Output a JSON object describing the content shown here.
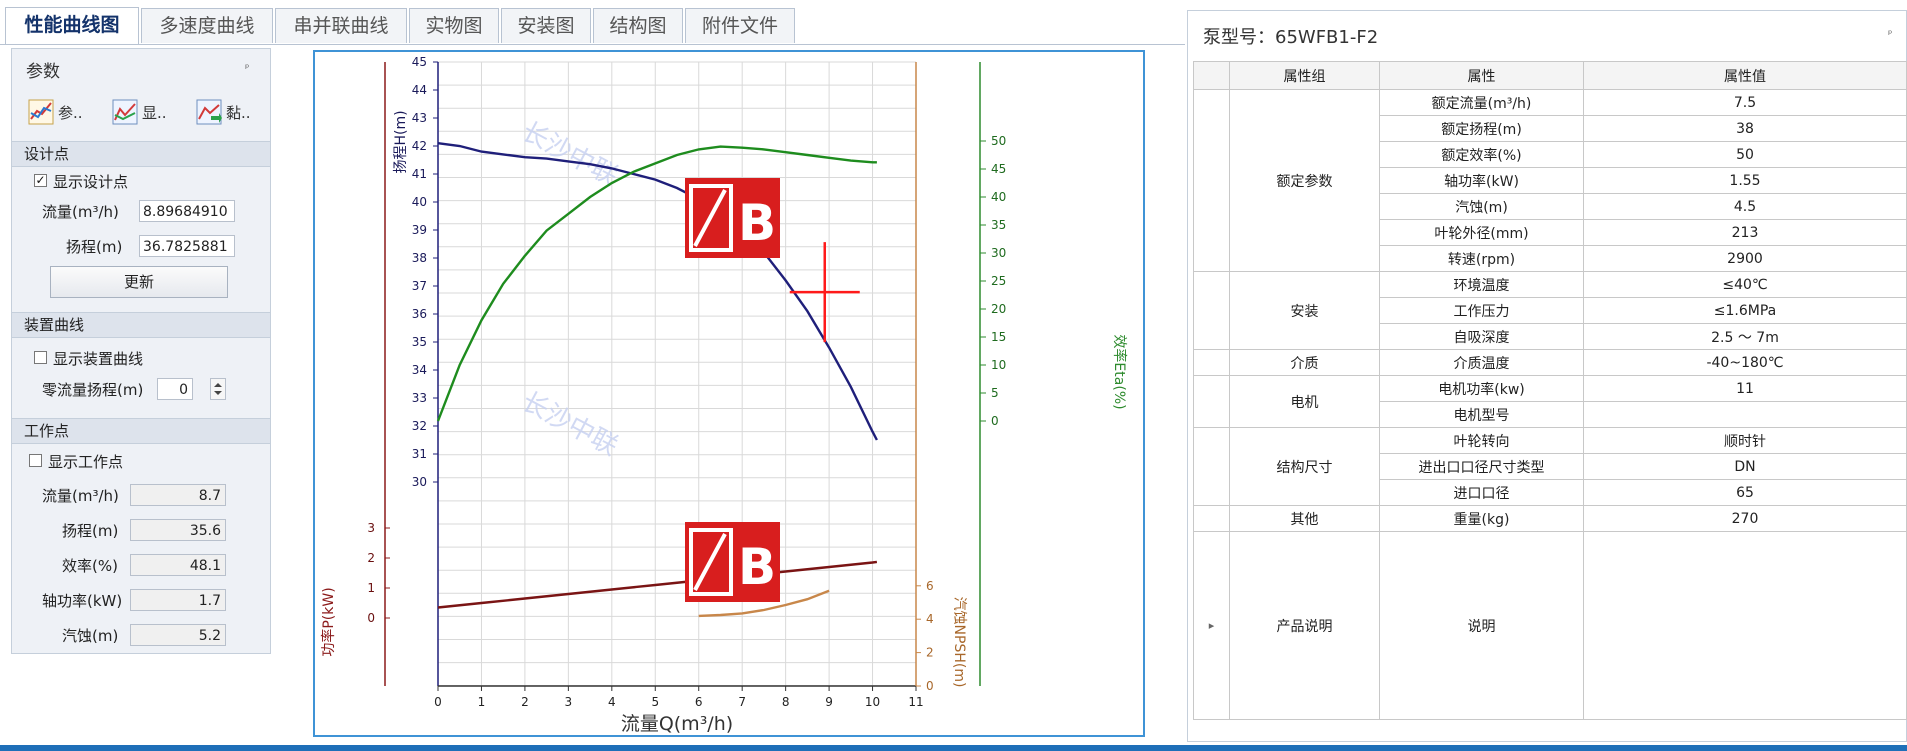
{
  "tabs": [
    "性能曲线图",
    "多速度曲线",
    "串并联曲线",
    "实物图",
    "安装图",
    "结构图",
    "附件文件"
  ],
  "left_panel": {
    "title": "参数",
    "pin_glyph": "ᵖ",
    "tools": [
      {
        "icon": "curve-chart-icon",
        "label": "参.."
      },
      {
        "icon": "display-chart-icon",
        "label": "显.."
      },
      {
        "icon": "paste-chart-icon",
        "label": "黏.."
      }
    ],
    "design_point": {
      "header": "设计点",
      "show_label": "显示设计点",
      "show_checked": true,
      "flow_label": "流量(m³/h)",
      "flow_value": "8.89684910",
      "head_label": "扬程(m)",
      "head_value": "36.7825881",
      "update_button": "更新"
    },
    "system_curve": {
      "header": "装置曲线",
      "show_label": "显示装置曲线",
      "show_checked": false,
      "zero_flow_label": "零流量扬程(m)",
      "zero_flow_value": "0"
    },
    "work_point": {
      "header": "工作点",
      "show_label": "显示工作点",
      "show_checked": false,
      "rows": [
        {
          "label": "流量(m³/h)",
          "value": "8.7"
        },
        {
          "label": "扬程(m)",
          "value": "35.6"
        },
        {
          "label": "效率(%)",
          "value": "48.1"
        },
        {
          "label": "轴功率(kW)",
          "value": "1.7"
        },
        {
          "label": "汽蚀(m)",
          "value": "5.2"
        }
      ]
    }
  },
  "chart_data": {
    "type": "line",
    "xlabel": "流量Q(m³/h)",
    "xlim": [
      0,
      11
    ],
    "x_ticks": [
      "0",
      "1",
      "2",
      "3",
      "4",
      "5",
      "6",
      "7",
      "8",
      "9",
      "10",
      "11"
    ],
    "head_axis": {
      "label": "扬程H(m)",
      "range": [
        30,
        45
      ],
      "ticks": [
        "30",
        "31",
        "32",
        "33",
        "34",
        "35",
        "36",
        "37",
        "38",
        "39",
        "40",
        "41",
        "42",
        "43",
        "44",
        "45"
      ],
      "color": "#8b1a1a"
    },
    "eta_axis": {
      "label": "效率Eta(%)",
      "range": [
        0,
        50
      ],
      "ticks": [
        "0",
        "5",
        "10",
        "15",
        "20",
        "25",
        "30",
        "35",
        "40",
        "45",
        "50"
      ],
      "color": "#2e8b2e"
    },
    "power_axis": {
      "label": "功率P(kW)",
      "range": [
        0,
        3
      ],
      "ticks": [
        "0",
        "1",
        "2",
        "3"
      ],
      "color": "#8b1a1a"
    },
    "npsh_axis": {
      "label": "汽蚀NPSH(m)",
      "range": [
        0,
        6
      ],
      "ticks": [
        "0",
        "2",
        "4",
        "6"
      ],
      "color": "#c8874a"
    },
    "series": [
      {
        "key": "head",
        "color": "#1f1f7a",
        "x": [
          0,
          0.5,
          1,
          1.5,
          2,
          2.5,
          3,
          3.5,
          4,
          4.5,
          5,
          5.5,
          6,
          6.5,
          7,
          7.5,
          8,
          8.5,
          9,
          9.5,
          10,
          10.1
        ],
        "y": [
          42.1,
          42.0,
          41.8,
          41.7,
          41.6,
          41.55,
          41.45,
          41.35,
          41.2,
          41.0,
          40.8,
          40.5,
          40.1,
          39.6,
          39.0,
          38.2,
          37.2,
          36.1,
          34.8,
          33.4,
          31.8,
          31.5
        ]
      },
      {
        "key": "eta",
        "color": "#1e8c1e",
        "x": [
          0,
          0.5,
          1,
          1.5,
          2,
          2.5,
          3,
          3.5,
          4,
          4.5,
          5,
          5.5,
          6,
          6.5,
          7,
          7.5,
          8,
          8.5,
          9,
          9.5,
          10,
          10.1
        ],
        "y": [
          0,
          10,
          18,
          24.5,
          29.5,
          34,
          37,
          40,
          42.5,
          44.5,
          46,
          47.5,
          48.5,
          49,
          48.8,
          48.5,
          48,
          47.5,
          47,
          46.5,
          46.2,
          46.2
        ]
      },
      {
        "key": "power",
        "color": "#7a1414",
        "x": [
          0,
          1,
          2,
          3,
          4,
          5,
          6,
          7,
          8,
          9,
          10,
          10.1
        ],
        "y": [
          0.35,
          0.5,
          0.65,
          0.8,
          0.95,
          1.1,
          1.25,
          1.4,
          1.55,
          1.7,
          1.85,
          1.87
        ]
      },
      {
        "key": "npsh",
        "color": "#c8874a",
        "x": [
          6,
          6.5,
          7,
          7.5,
          8,
          8.5,
          9
        ],
        "y": [
          4.2,
          4.25,
          4.35,
          4.55,
          4.85,
          5.2,
          5.7
        ]
      }
    ],
    "design_point": {
      "x": 8.9,
      "head": 36.78
    },
    "watermark_text": "长沙中联",
    "logo_text": "ZB"
  },
  "right_panel": {
    "title": "泵型号：65WFB1-F2",
    "pin_glyph": "ᵖ",
    "columns": [
      "属性组",
      "属性",
      "属性值"
    ],
    "groups": [
      {
        "name": "额定参数",
        "rows": [
          [
            "额定流量(m³/h)",
            "7.5"
          ],
          [
            "额定扬程(m)",
            "38"
          ],
          [
            "额定效率(%)",
            "50"
          ],
          [
            "轴功率(kW)",
            "1.55"
          ],
          [
            "汽蚀(m)",
            "4.5"
          ],
          [
            "叶轮外径(mm)",
            "213"
          ],
          [
            "转速(rpm)",
            "2900"
          ]
        ]
      },
      {
        "name": "安装",
        "rows": [
          [
            "环境温度",
            "≤40℃"
          ],
          [
            "工作压力",
            "≤1.6MPa"
          ],
          [
            "自吸深度",
            "2.5 ～ 7m"
          ]
        ]
      },
      {
        "name": "介质",
        "rows": [
          [
            "介质温度",
            "-40~180℃"
          ]
        ]
      },
      {
        "name": "电机",
        "rows": [
          [
            "电机功率(kw)",
            "11"
          ],
          [
            "电机型号",
            ""
          ]
        ]
      },
      {
        "name": "结构尺寸",
        "rows": [
          [
            "叶轮转向",
            "顺时针"
          ],
          [
            "进出口口径尺寸类型",
            "DN"
          ],
          [
            "进口口径",
            "65"
          ]
        ]
      },
      {
        "name": "其他",
        "rows": [
          [
            "重量(kg)",
            "270"
          ]
        ]
      },
      {
        "name": "产品说明",
        "rows": [
          [
            "说明",
            ""
          ]
        ]
      }
    ]
  }
}
